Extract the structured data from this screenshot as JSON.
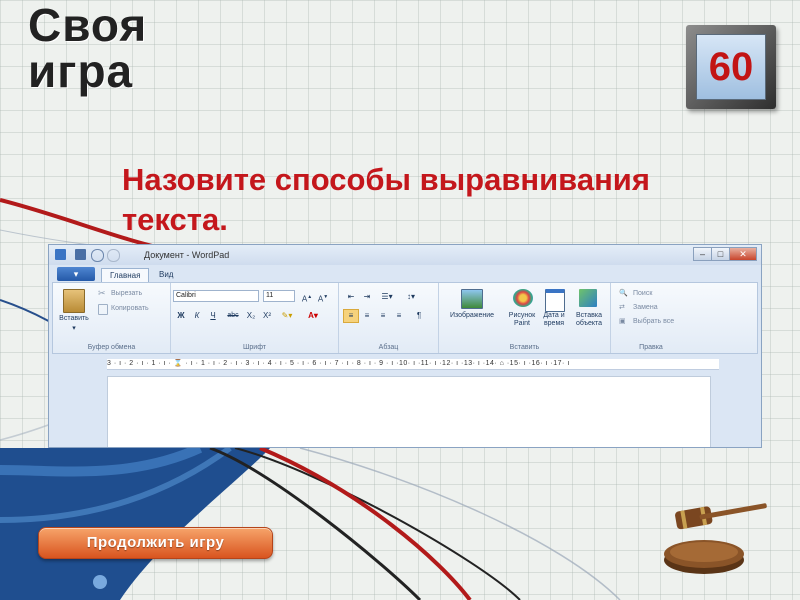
{
  "slide": {
    "title": "Своя игра",
    "score": "60",
    "question": "Назовите способы выравнивания текста.",
    "continue_label": "Продолжить игру"
  },
  "wordpad": {
    "window_title": "Документ - WordPad",
    "file_tab": "▾",
    "tabs": [
      "Главная",
      "Вид"
    ],
    "clipboard": {
      "paste": "Вставить",
      "cut": "Вырезать",
      "copy": "Копировать",
      "group": "Буфер обмена"
    },
    "font": {
      "name": "Calibri",
      "size": "11",
      "group": "Шрифт",
      "buttons": [
        "Ж",
        "К",
        "Ч",
        "abc",
        "X₂",
        "X²"
      ]
    },
    "paragraph": {
      "group": "Абзац"
    },
    "insert": {
      "image": "Изображение",
      "paint": "Рисунок Paint",
      "datetime": "Дата и время",
      "object": "Вставка объекта",
      "group": "Вставить"
    },
    "editing": {
      "find": "Поиск",
      "replace": "Замена",
      "select_all": "Выбрать все",
      "group": "Правка"
    },
    "ruler": "3 · ı · 2 · ı · 1 · ı · ⌛ · ı · 1 · ı · 2 · ı · 3 · ı · 4 · ı · 5 · ı · 6 · ı · 7 · ı · 8 · ı · 9 · ı ·10· ı ·11· ı ·12· ı ·13· ı ·14· ⌂ ·15· ı ·16· ı ·17· ı"
  },
  "colors": {
    "title": "#222222",
    "question": "#c4171c",
    "score": "#c21414",
    "button": "#e0622a",
    "accent_blue": "#1f4e8f"
  },
  "icons": [
    "gavel-icon",
    "paste-icon",
    "cut-icon",
    "copy-icon",
    "image-icon",
    "paint-icon",
    "calendar-icon",
    "object-icon",
    "find-icon",
    "replace-icon",
    "select-all-icon"
  ]
}
